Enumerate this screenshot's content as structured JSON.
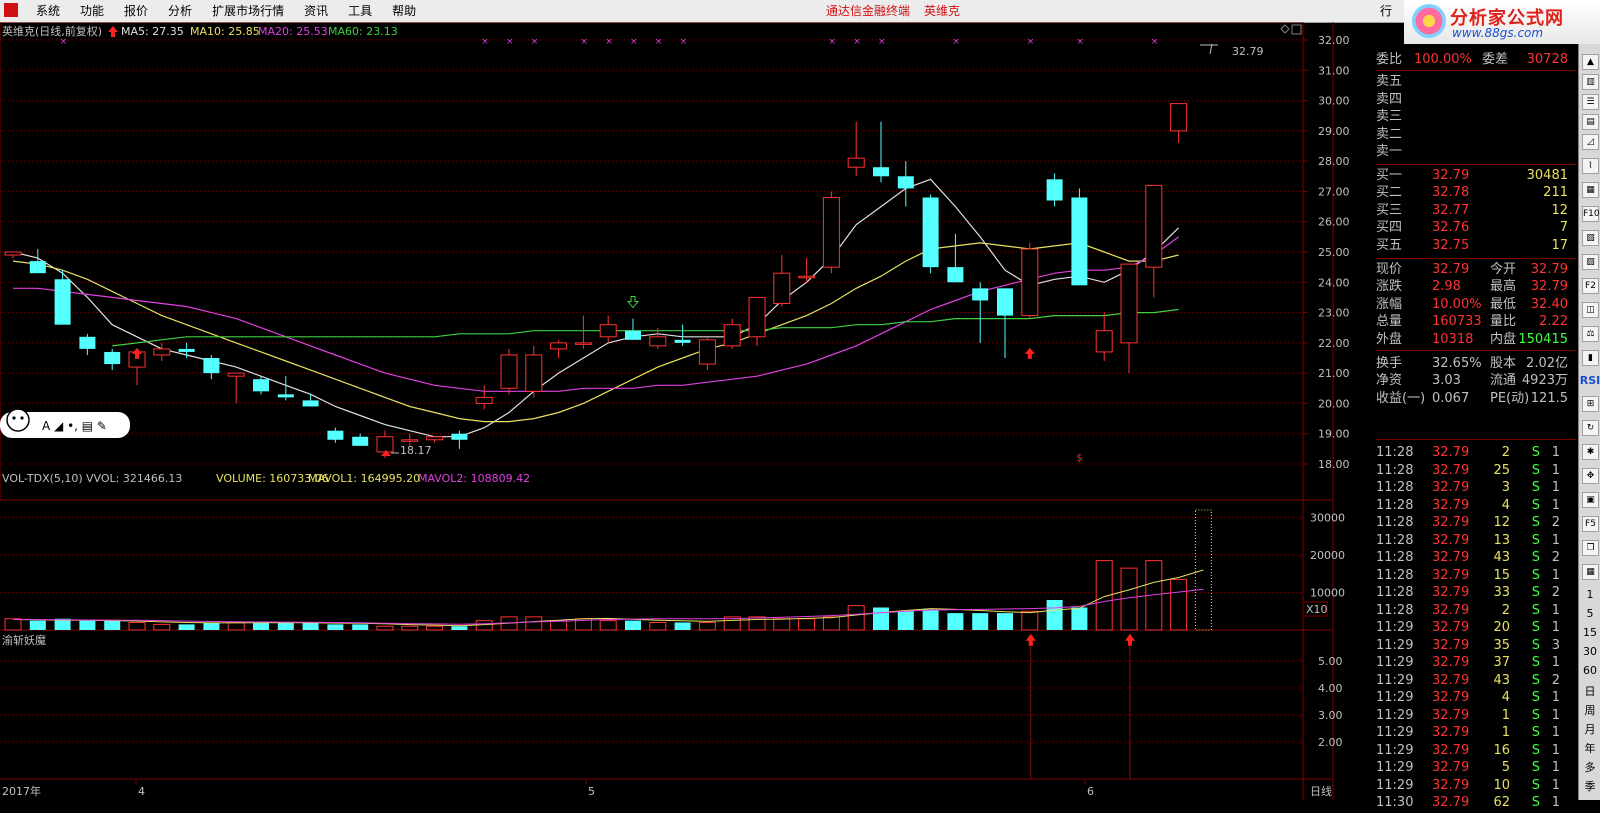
{
  "menu": {
    "items": [
      "系统",
      "功能",
      "报价",
      "分析",
      "扩展市场行情",
      "资讯",
      "工具",
      "帮助"
    ],
    "center_title": "通达信金融终端",
    "stock_name": "英维克",
    "quote_tab": "行"
  },
  "brand": {
    "name": "分析家公式网",
    "url": "www.88gs.com"
  },
  "main_chart": {
    "header_name": "英维克(日线,前复权)",
    "ma5": "MA5: 27.35",
    "ma10": "MA10: 25.85",
    "ma20": "MA20: 25.53",
    "ma60": "MA60: 23.13",
    "high_label": "32.79",
    "low_label": "18.17",
    "y_ticks": [
      "32.00",
      "31.00",
      "30.00",
      "29.00",
      "28.00",
      "27.00",
      "26.00",
      "25.00",
      "24.00",
      "23.00",
      "22.00",
      "21.00",
      "20.00",
      "19.00",
      "18.00"
    ],
    "toolbar_glyphs": "A ◢ •, ▤ ✎"
  },
  "volume": {
    "header": "VOL-TDX(5,10)",
    "vvol": "VVOL: 321466.13",
    "volume": "VOLUME: 160733.06",
    "mavol1": "MAVOL1: 164995.20",
    "mavol2": "MAVOL2: 108809.42",
    "y_ticks": [
      "30000",
      "20000",
      "10000"
    ],
    "multiplier": "X10"
  },
  "indicator": {
    "name": "渝斩妖魔",
    "y_ticks": [
      "5.00",
      "4.00",
      "3.00",
      "2.00"
    ]
  },
  "x_axis": {
    "labels": [
      "2017年",
      "4",
      "5",
      "6"
    ],
    "period": "日线"
  },
  "chart_data": [
    {
      "type": "candlestick",
      "title": "英维克(日线,前复权)",
      "ylim": [
        18,
        32.8
      ],
      "candles": [
        {
          "o": 24.9,
          "h": 25.0,
          "l": 24.8,
          "c": 25.0
        },
        {
          "o": 24.7,
          "h": 25.1,
          "l": 24.6,
          "c": 24.3
        },
        {
          "o": 24.1,
          "h": 24.4,
          "l": 23.9,
          "c": 22.6
        },
        {
          "o": 22.2,
          "h": 22.3,
          "l": 21.6,
          "c": 21.8
        },
        {
          "o": 21.7,
          "h": 21.8,
          "l": 21.1,
          "c": 21.3
        },
        {
          "o": 21.2,
          "h": 21.8,
          "l": 20.6,
          "c": 21.7
        },
        {
          "o": 21.6,
          "h": 22.0,
          "l": 21.4,
          "c": 21.8
        },
        {
          "o": 21.8,
          "h": 22.0,
          "l": 21.5,
          "c": 21.7
        },
        {
          "o": 21.5,
          "h": 21.6,
          "l": 20.8,
          "c": 21.0
        },
        {
          "o": 20.9,
          "h": 21.0,
          "l": 20.0,
          "c": 21.0
        },
        {
          "o": 20.8,
          "h": 20.9,
          "l": 20.3,
          "c": 20.4
        },
        {
          "o": 20.3,
          "h": 20.9,
          "l": 20.1,
          "c": 20.2
        },
        {
          "o": 20.1,
          "h": 20.3,
          "l": 19.9,
          "c": 19.9
        },
        {
          "o": 19.1,
          "h": 19.2,
          "l": 18.7,
          "c": 18.8
        },
        {
          "o": 18.9,
          "h": 19.0,
          "l": 18.6,
          "c": 18.6
        },
        {
          "o": 18.4,
          "h": 19.1,
          "l": 18.2,
          "c": 18.9
        },
        {
          "o": 18.8,
          "h": 19.0,
          "l": 18.6,
          "c": 18.8
        },
        {
          "o": 18.8,
          "h": 18.9,
          "l": 18.7,
          "c": 18.9
        },
        {
          "o": 19.0,
          "h": 19.1,
          "l": 18.5,
          "c": 18.8
        },
        {
          "o": 20.0,
          "h": 20.6,
          "l": 19.8,
          "c": 20.2
        },
        {
          "o": 20.5,
          "h": 21.8,
          "l": 20.3,
          "c": 21.6
        },
        {
          "o": 20.4,
          "h": 21.9,
          "l": 20.2,
          "c": 21.6
        },
        {
          "o": 21.8,
          "h": 22.1,
          "l": 21.5,
          "c": 22.0
        },
        {
          "o": 22.0,
          "h": 22.9,
          "l": 21.8,
          "c": 22.0
        },
        {
          "o": 22.2,
          "h": 22.9,
          "l": 22.0,
          "c": 22.6
        },
        {
          "o": 22.4,
          "h": 22.8,
          "l": 22.1,
          "c": 22.1
        },
        {
          "o": 21.9,
          "h": 22.5,
          "l": 21.8,
          "c": 22.2
        },
        {
          "o": 22.1,
          "h": 22.6,
          "l": 21.9,
          "c": 22.0
        },
        {
          "o": 21.3,
          "h": 22.2,
          "l": 21.1,
          "c": 22.1
        },
        {
          "o": 21.9,
          "h": 22.8,
          "l": 21.8,
          "c": 22.6
        },
        {
          "o": 22.2,
          "h": 23.5,
          "l": 21.9,
          "c": 23.5
        },
        {
          "o": 23.3,
          "h": 24.9,
          "l": 23.2,
          "c": 24.3
        },
        {
          "o": 24.2,
          "h": 24.8,
          "l": 24.0,
          "c": 24.2
        },
        {
          "o": 24.5,
          "h": 27.0,
          "l": 24.3,
          "c": 26.8
        },
        {
          "o": 27.8,
          "h": 29.3,
          "l": 27.5,
          "c": 28.1
        },
        {
          "o": 27.8,
          "h": 29.3,
          "l": 27.3,
          "c": 27.5
        },
        {
          "o": 27.5,
          "h": 28.0,
          "l": 26.5,
          "c": 27.1
        },
        {
          "o": 26.8,
          "h": 26.9,
          "l": 24.3,
          "c": 24.5
        },
        {
          "o": 24.5,
          "h": 25.6,
          "l": 24.0,
          "c": 24.0
        },
        {
          "o": 23.8,
          "h": 24.0,
          "l": 22.0,
          "c": 23.4
        },
        {
          "o": 23.8,
          "h": 23.8,
          "l": 21.5,
          "c": 22.9
        },
        {
          "o": 22.9,
          "h": 25.3,
          "l": 22.8,
          "c": 25.1
        },
        {
          "o": 27.4,
          "h": 27.6,
          "l": 26.5,
          "c": 26.7
        },
        {
          "o": 26.8,
          "h": 27.1,
          "l": 23.9,
          "c": 23.9
        },
        {
          "o": 21.7,
          "h": 23.0,
          "l": 21.4,
          "c": 22.4
        },
        {
          "o": 22.0,
          "h": 24.6,
          "l": 21.0,
          "c": 24.6
        },
        {
          "o": 24.5,
          "h": 27.2,
          "l": 23.5,
          "c": 27.2
        },
        {
          "o": 29.0,
          "h": 29.9,
          "l": 28.6,
          "c": 29.9
        }
      ],
      "series": [
        {
          "name": "MA5",
          "values": [
            25.0,
            24.8,
            24.3,
            23.5,
            22.6,
            22.2,
            21.8,
            21.6,
            21.4,
            21.2,
            20.9,
            20.6,
            20.3,
            19.9,
            19.6,
            19.3,
            19.1,
            18.9,
            18.9,
            19.2,
            19.7,
            20.4,
            21.0,
            21.5,
            22.0,
            22.2,
            22.3,
            22.2,
            22.2,
            22.2,
            22.6,
            23.4,
            24.0,
            24.8,
            25.9,
            26.5,
            27.1,
            27.4,
            26.5,
            25.5,
            24.4,
            23.9,
            24.1,
            24.2,
            24.0,
            24.4,
            25.0,
            25.8
          ]
        },
        {
          "name": "MA10",
          "values": [
            24.7,
            24.6,
            24.4,
            24.1,
            23.7,
            23.3,
            22.9,
            22.6,
            22.3,
            22.0,
            21.7,
            21.4,
            21.1,
            20.8,
            20.5,
            20.2,
            19.9,
            19.7,
            19.5,
            19.4,
            19.4,
            19.5,
            19.7,
            20.0,
            20.4,
            20.8,
            21.2,
            21.5,
            21.8,
            22.0,
            22.3,
            22.6,
            22.9,
            23.3,
            23.8,
            24.2,
            24.7,
            25.1,
            25.2,
            25.3,
            25.2,
            25.1,
            25.2,
            25.3,
            25.0,
            24.7,
            24.7,
            24.9
          ]
        },
        {
          "name": "MA20",
          "values": [
            23.8,
            23.8,
            23.7,
            23.6,
            23.5,
            23.4,
            23.3,
            23.2,
            23.0,
            22.8,
            22.5,
            22.2,
            21.9,
            21.6,
            21.3,
            21.0,
            20.8,
            20.6,
            20.5,
            20.4,
            20.4,
            20.4,
            20.4,
            20.5,
            20.5,
            20.5,
            20.6,
            20.6,
            20.7,
            20.8,
            20.9,
            21.1,
            21.3,
            21.6,
            21.9,
            22.3,
            22.7,
            23.1,
            23.4,
            23.7,
            23.9,
            24.1,
            24.3,
            24.4,
            24.4,
            24.5,
            24.9,
            25.5
          ]
        },
        {
          "name": "MA60",
          "values": [
            null,
            null,
            null,
            null,
            21.9,
            22.0,
            22.1,
            22.2,
            22.2,
            22.2,
            22.2,
            22.2,
            22.2,
            22.2,
            22.2,
            22.2,
            22.2,
            22.2,
            22.3,
            22.3,
            22.3,
            22.4,
            22.4,
            22.4,
            22.4,
            22.4,
            22.4,
            22.4,
            22.4,
            22.4,
            22.4,
            22.5,
            22.5,
            22.5,
            22.6,
            22.6,
            22.7,
            22.7,
            22.8,
            22.8,
            22.8,
            22.8,
            22.9,
            22.9,
            22.9,
            23.0,
            23.0,
            23.1
          ]
        }
      ]
    },
    {
      "type": "bar",
      "title": "VOL-TDX(5,10)",
      "ylim": [
        0,
        32000
      ],
      "values": [
        3000,
        2500,
        3000,
        2500,
        2500,
        2000,
        1500,
        1500,
        2000,
        2000,
        2000,
        2000,
        2000,
        1500,
        1500,
        1000,
        1000,
        1000,
        1000,
        2500,
        3500,
        3500,
        2500,
        3000,
        2500,
        2500,
        2000,
        2000,
        2000,
        3500,
        3500,
        3000,
        3000,
        3500,
        6500,
        6000,
        5000,
        5500,
        4500,
        4500,
        4500,
        5000,
        8000,
        6000,
        18500,
        16500,
        18500,
        13500,
        16000
      ],
      "series": [
        {
          "name": "MAVOL1",
          "values": [
            2800,
            2750,
            2650,
            2600,
            2500,
            2400,
            2150,
            2000,
            1900,
            1900,
            1950,
            1950,
            1950,
            1850,
            1800,
            1650,
            1450,
            1300,
            1150,
            1450,
            1850,
            2250,
            2600,
            3000,
            3100,
            2850,
            2600,
            2450,
            2300,
            2550,
            2800,
            2900,
            3100,
            3300,
            4000,
            4650,
            5200,
            5700,
            5500,
            5200,
            4850,
            4650,
            5300,
            5800,
            8900,
            10700,
            12700,
            14000,
            16000
          ]
        },
        {
          "name": "MAVOL2",
          "values": [
            2800,
            2780,
            2720,
            2680,
            2650,
            2600,
            2500,
            2380,
            2280,
            2200,
            2150,
            2100,
            2050,
            2000,
            1950,
            1800,
            1700,
            1620,
            1550,
            1650,
            1900,
            2150,
            2350,
            2550,
            2800,
            2900,
            3000,
            3000,
            3000,
            3050,
            3200,
            3400,
            3600,
            3850,
            4200,
            4600,
            5000,
            5300,
            5450,
            5500,
            5600,
            5700,
            5900,
            6300,
            7600,
            8600,
            9400,
            10100,
            10880
          ]
        }
      ]
    }
  ],
  "quote": {
    "wb_label": "委比",
    "wb_value": "100.00%",
    "wc_label": "委差",
    "wc_value": "30728",
    "sell_labels": [
      "卖五",
      "卖四",
      "卖三",
      "卖二",
      "卖一"
    ],
    "buys": [
      {
        "label": "买一",
        "price": "32.79",
        "vol": "30481"
      },
      {
        "label": "买二",
        "price": "32.78",
        "vol": "211"
      },
      {
        "label": "买三",
        "price": "32.77",
        "vol": "12"
      },
      {
        "label": "买四",
        "price": "32.76",
        "vol": "7"
      },
      {
        "label": "买五",
        "price": "32.75",
        "vol": "17"
      }
    ],
    "stats": [
      {
        "l1": "现价",
        "v1": "32.79",
        "l2": "今开",
        "v2": "32.79"
      },
      {
        "l1": "涨跌",
        "v1": "2.98",
        "l2": "最高",
        "v2": "32.79"
      },
      {
        "l1": "涨幅",
        "v1": "10.00%",
        "l2": "最低",
        "v2": "32.40"
      },
      {
        "l1": "总量",
        "v1": "160733",
        "l2": "量比",
        "v2": "2.22"
      },
      {
        "l1": "外盘",
        "v1": "10318",
        "l2": "内盘",
        "v2": "150415"
      }
    ],
    "fund": [
      {
        "l1": "换手",
        "v1": "32.65%",
        "l2": "股本",
        "v2": "2.02亿"
      },
      {
        "l1": "净资",
        "v1": "3.03",
        "l2": "流通",
        "v2": "4923万"
      },
      {
        "l1": "收益(一)",
        "v1": "0.067",
        "l2": "PE(动)",
        "v2": "121.5"
      }
    ],
    "ticks": [
      {
        "t": "11:28",
        "p": "32.79",
        "v": "2",
        "s": "S",
        "n": "1"
      },
      {
        "t": "11:28",
        "p": "32.79",
        "v": "25",
        "s": "S",
        "n": "1"
      },
      {
        "t": "11:28",
        "p": "32.79",
        "v": "3",
        "s": "S",
        "n": "1"
      },
      {
        "t": "11:28",
        "p": "32.79",
        "v": "4",
        "s": "S",
        "n": "1"
      },
      {
        "t": "11:28",
        "p": "32.79",
        "v": "12",
        "s": "S",
        "n": "2"
      },
      {
        "t": "11:28",
        "p": "32.79",
        "v": "13",
        "s": "S",
        "n": "1"
      },
      {
        "t": "11:28",
        "p": "32.79",
        "v": "43",
        "s": "S",
        "n": "2"
      },
      {
        "t": "11:28",
        "p": "32.79",
        "v": "15",
        "s": "S",
        "n": "1"
      },
      {
        "t": "11:28",
        "p": "32.79",
        "v": "33",
        "s": "S",
        "n": "2"
      },
      {
        "t": "11:28",
        "p": "32.79",
        "v": "2",
        "s": "S",
        "n": "1"
      },
      {
        "t": "11:29",
        "p": "32.79",
        "v": "20",
        "s": "S",
        "n": "1"
      },
      {
        "t": "11:29",
        "p": "32.79",
        "v": "35",
        "s": "S",
        "n": "3"
      },
      {
        "t": "11:29",
        "p": "32.79",
        "v": "37",
        "s": "S",
        "n": "1"
      },
      {
        "t": "11:29",
        "p": "32.79",
        "v": "43",
        "s": "S",
        "n": "2"
      },
      {
        "t": "11:29",
        "p": "32.79",
        "v": "4",
        "s": "S",
        "n": "1"
      },
      {
        "t": "11:29",
        "p": "32.79",
        "v": "1",
        "s": "S",
        "n": "1"
      },
      {
        "t": "11:29",
        "p": "32.79",
        "v": "1",
        "s": "S",
        "n": "1"
      },
      {
        "t": "11:29",
        "p": "32.79",
        "v": "16",
        "s": "S",
        "n": "1"
      },
      {
        "t": "11:29",
        "p": "32.79",
        "v": "5",
        "s": "S",
        "n": "1"
      },
      {
        "t": "11:29",
        "p": "32.79",
        "v": "10",
        "s": "S",
        "n": "1"
      },
      {
        "t": "11:30",
        "p": "32.79",
        "v": "62",
        "s": "S",
        "n": "1"
      }
    ]
  },
  "sidebar": {
    "periods": [
      "1",
      "5",
      "15",
      "30",
      "60",
      "日",
      "周",
      "月",
      "年",
      "多",
      "季",
      "年"
    ],
    "rsi_label": "RSI",
    "fg_label": "F10",
    "f2_label": "F2"
  },
  "colors": {
    "up": "#ff3232",
    "down": "#54ffff",
    "ma5": "#e0e0e0",
    "ma10": "#e8e060",
    "ma20": "#e040e0",
    "ma60": "#40d040",
    "grid": "#800000"
  }
}
